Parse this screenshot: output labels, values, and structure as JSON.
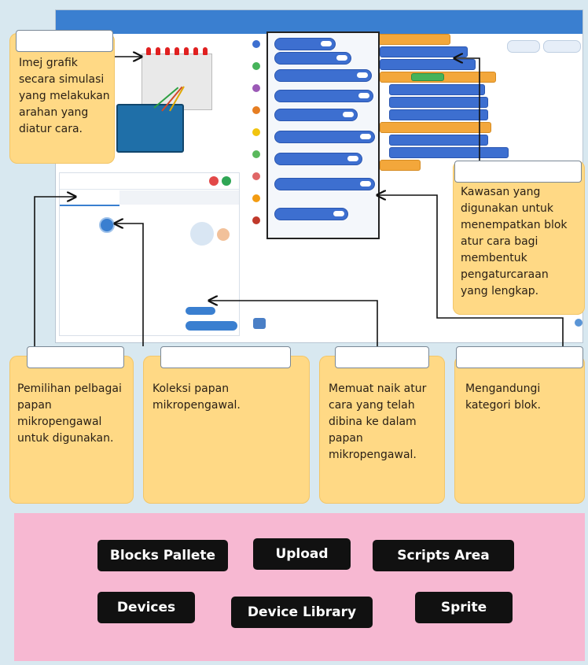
{
  "notes": {
    "simulation": "Imej grafik secara simulasi yang melakukan arahan yang diatur cara.",
    "scripts_area": "Kawasan yang digunakan untuk menempatkan blok atur cara bagi membentuk pengaturcaraan yang lengkap.",
    "devices": "Pemilihan pelbagai papan mikropengawal untuk digunakan.",
    "device_library": "Koleksi papan mikropengawal.",
    "upload": "Memuat naik atur cara yang telah dibina ke dalam papan mikropengawal.",
    "blocks_pallete": "Mengandungi kategori blok."
  },
  "answer_bank": {
    "chips": [
      "Blocks Pallete",
      "Upload",
      "Scripts Area",
      "Devices",
      "Device Library",
      "Sprite"
    ]
  },
  "colors": {
    "note_bg": "#ffd985",
    "bank_bg": "#f7b8d2",
    "chip_bg": "#111111",
    "chip_text": "#ffffff",
    "app_topbar": "#3a7fd0",
    "block_blue": "#3d6fd0",
    "block_orange": "#f3a73b"
  }
}
